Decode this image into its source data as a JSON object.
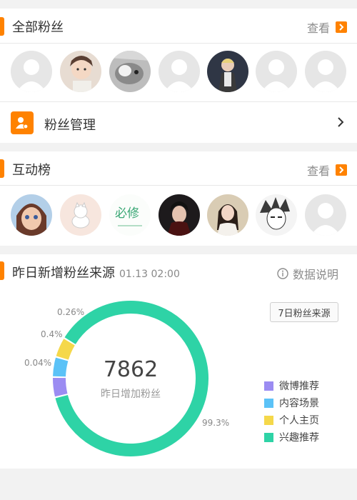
{
  "all_fans": {
    "title": "全部粉丝",
    "view_label": "查看",
    "avatars": [
      "default-avatar",
      "girl-photo-avatar",
      "cat-photo-avatar",
      "default-avatar",
      "man-blonde-avatar",
      "default-avatar",
      "default-avatar"
    ]
  },
  "fan_management": {
    "label": "粉丝管理"
  },
  "interaction_ranking": {
    "title": "互动榜",
    "view_label": "查看",
    "avatars": [
      "cartoon-girl-avatar",
      "cat-drawing-avatar",
      "text-logo-avatar",
      "man-dark-avatar",
      "woman-photo-avatar",
      "manga-avatar",
      "default-avatar"
    ],
    "logo_text": "必修"
  },
  "fan_sources": {
    "title": "昨日新增粉丝来源",
    "date": "01.13 02:00",
    "info_label": "数据说明",
    "period_button": "7日粉丝来源",
    "total": "7862",
    "total_label": "昨日增加粉丝"
  },
  "colors": {
    "accent": "#ff8200",
    "weibo": "#9b8cf2",
    "content": "#5bc2f7",
    "profile": "#f5d84a",
    "interest": "#2ed3a6"
  },
  "chart_data": {
    "type": "pie",
    "donut": true,
    "categories": [
      "微博推荐",
      "内容场景",
      "个人主页",
      "兴趣推荐"
    ],
    "values": [
      0.04,
      0.4,
      0.26,
      99.3
    ],
    "value_labels": [
      "0.04%",
      "0.4%",
      "0.26%",
      "99.3%"
    ],
    "colors": [
      "#9b8cf2",
      "#5bc2f7",
      "#f5d84a",
      "#2ed3a6"
    ],
    "legend_position": "right"
  }
}
